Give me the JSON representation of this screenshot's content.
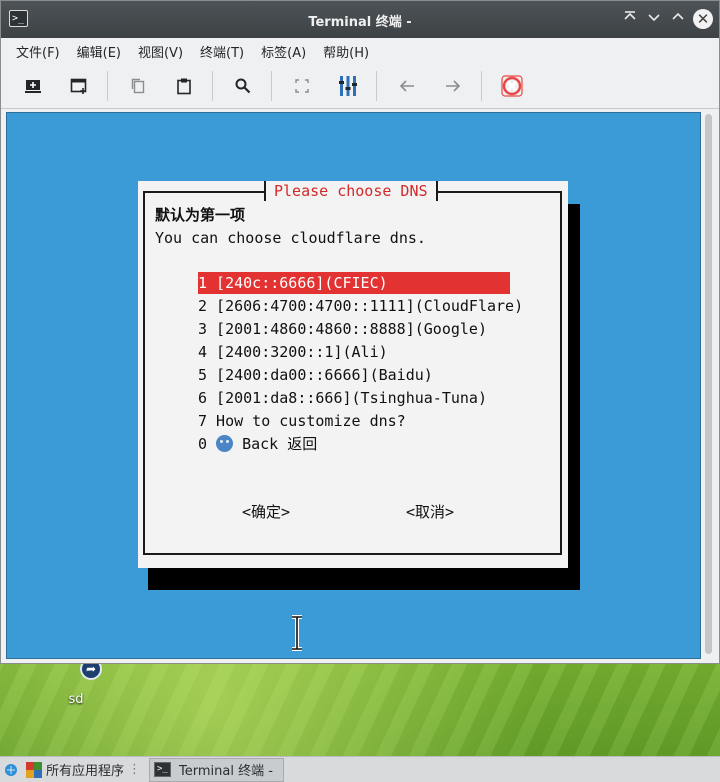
{
  "window": {
    "title": "Terminal 终端 -",
    "app_icon": ">_",
    "controls": {
      "shade": "⌃",
      "minimize": "⌄",
      "maximize": "⌃",
      "close": "✕"
    }
  },
  "menubar": [
    "文件(F)",
    "编辑(E)",
    "视图(V)",
    "终端(T)",
    "标签(A)",
    "帮助(H)"
  ],
  "toolbar": {
    "icons": [
      "new-tab-icon",
      "new-window-icon",
      "copy-icon",
      "paste-icon",
      "find-icon",
      "fullscreen-icon",
      "split-view-icon",
      "previous-tab-icon",
      "next-tab-icon",
      "close-tab-icon"
    ]
  },
  "dialog": {
    "title": "Please choose DNS",
    "heading": "默认为第一项",
    "subtitle": "You can choose cloudflare dns.",
    "options": [
      "1 [240c::6666](CFIEC)",
      "2 [2606:4700:4700::1111](CloudFlare)",
      "3 [2001:4860:4860::8888](Google)",
      "4 [2400:3200::1](Ali)",
      "5 [2400:da00::6666](Baidu)",
      "6 [2001:da8::666](Tsinghua-Tuna)",
      "7 How to customize dns?"
    ],
    "back_option": {
      "number": "0",
      "text": "Back 返回"
    },
    "selected_index": 0,
    "ok_button": "<确定>",
    "cancel_button": "<取消>"
  },
  "desktop": {
    "icon_label": "sd"
  },
  "taskbar": {
    "start_label": "所有应用程序",
    "task_label": "Terminal 终端 -"
  },
  "colors": {
    "terminal_bg": "#3b9bd6",
    "dialog_title": "#d12a2a",
    "selection": "#e23232"
  }
}
